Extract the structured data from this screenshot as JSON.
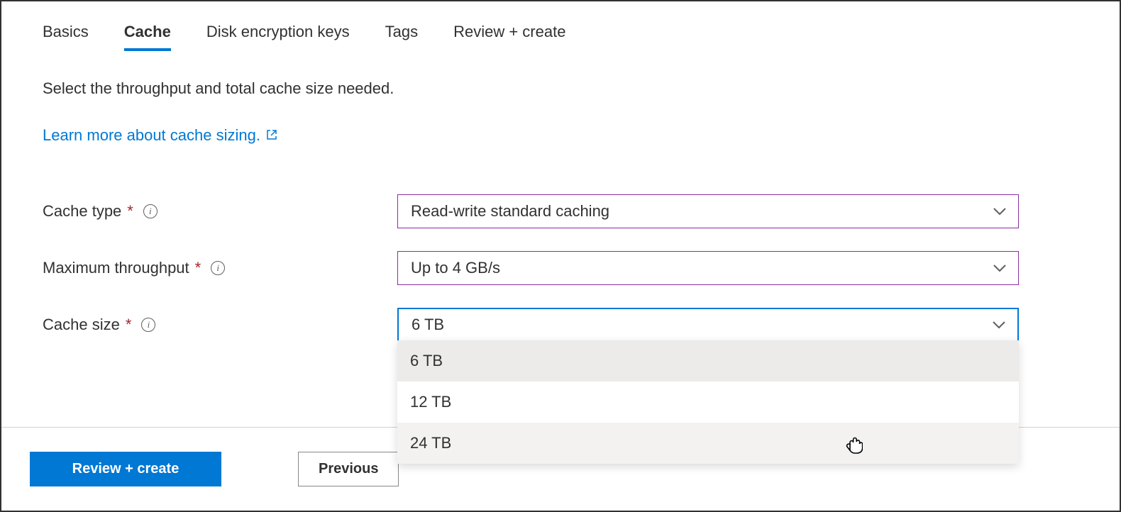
{
  "tabs": [
    {
      "label": "Basics"
    },
    {
      "label": "Cache"
    },
    {
      "label": "Disk encryption keys"
    },
    {
      "label": "Tags"
    },
    {
      "label": "Review + create"
    }
  ],
  "active_tab_index": 1,
  "intro_text": "Select the throughput and total cache size needed.",
  "learn_link_text": "Learn more about cache sizing.",
  "fields": {
    "cache_type": {
      "label": "Cache type",
      "value": "Read-write standard caching"
    },
    "max_throughput": {
      "label": "Maximum throughput",
      "value": "Up to 4 GB/s"
    },
    "cache_size": {
      "label": "Cache size",
      "value": "6 TB",
      "options": [
        "6 TB",
        "12 TB",
        "24 TB"
      ],
      "selected_index": 0,
      "hover_index": 2
    }
  },
  "footer": {
    "review_label": "Review + create",
    "previous_label": "Previous"
  },
  "colors": {
    "accent": "#0078d4",
    "link": "#0078d4",
    "required": "#a4262c",
    "select_border": "#8a2da5"
  }
}
